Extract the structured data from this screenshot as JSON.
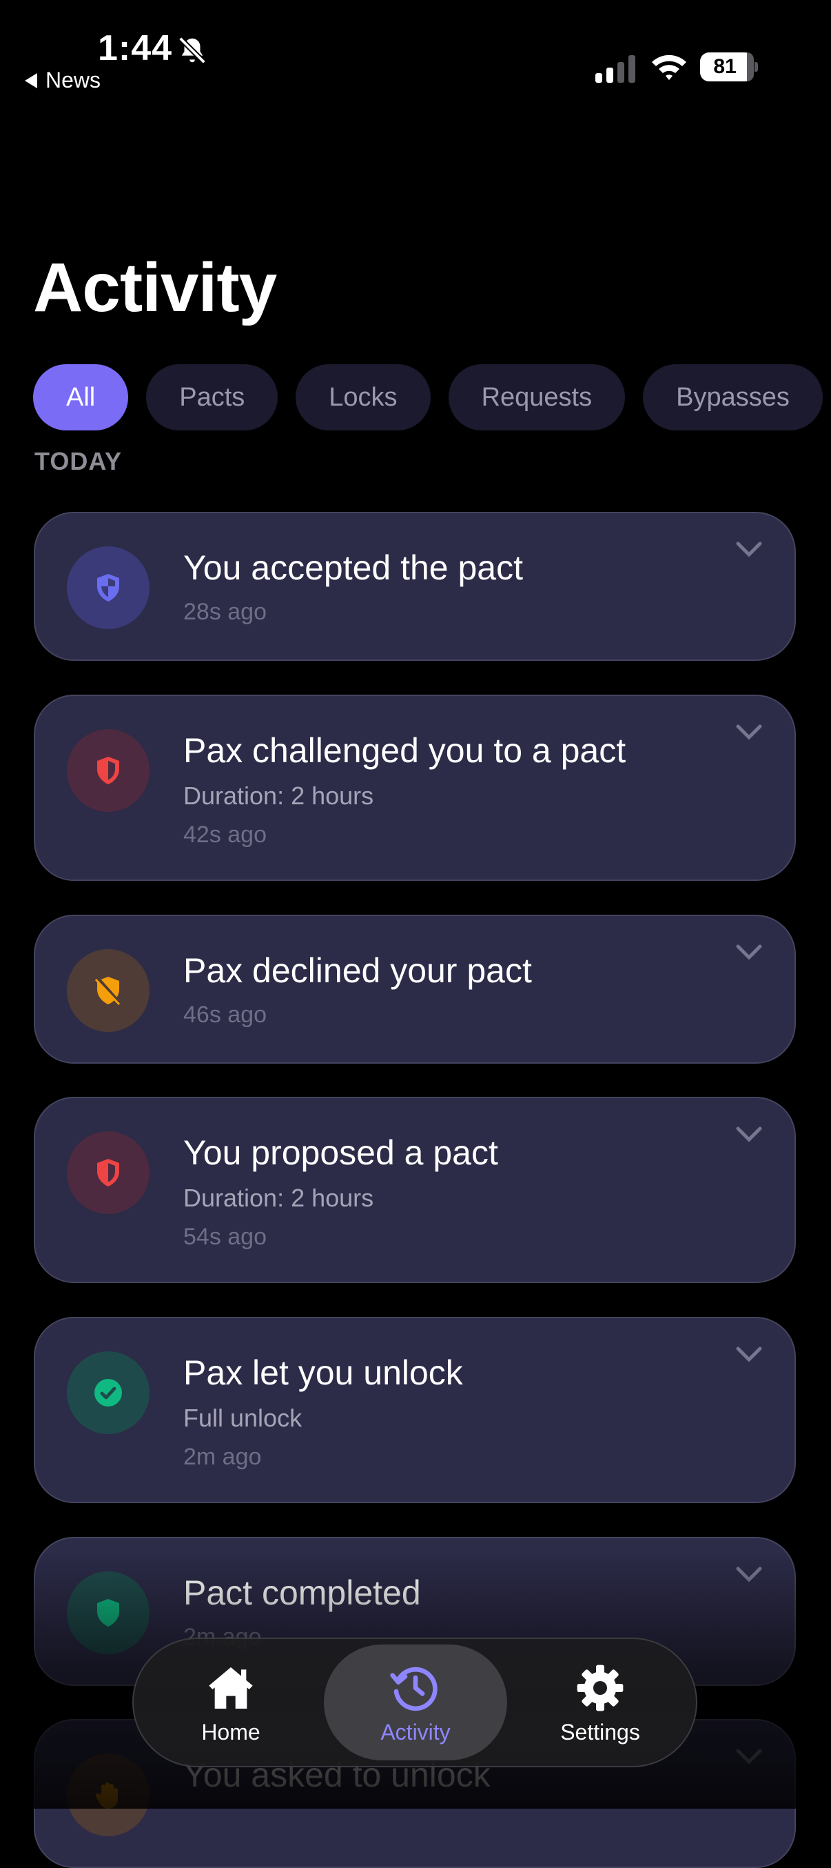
{
  "status_bar": {
    "time": "1:44",
    "back_label": "News",
    "battery": "81"
  },
  "header": {
    "title": "Activity"
  },
  "filters": [
    {
      "label": "All",
      "active": true
    },
    {
      "label": "Pacts",
      "active": false
    },
    {
      "label": "Locks",
      "active": false
    },
    {
      "label": "Requests",
      "active": false
    },
    {
      "label": "Bypasses",
      "active": false
    }
  ],
  "section": {
    "label": "TODAY"
  },
  "activities": [
    {
      "title": "You accepted the pact",
      "detail": "",
      "time": "28s ago",
      "icon": "shield-half-icon",
      "color": "#6a6df0"
    },
    {
      "title": "Pax challenged you to a pact",
      "detail": "Duration: 2 hours",
      "time": "42s ago",
      "icon": "shield-half-icon",
      "color": "#ef4444"
    },
    {
      "title": "Pax declined your pact",
      "detail": "",
      "time": "46s ago",
      "icon": "shield-slash-icon",
      "color": "#f59e0b"
    },
    {
      "title": "You proposed a pact",
      "detail": "Duration: 2 hours",
      "time": "54s ago",
      "icon": "shield-half-icon",
      "color": "#ef4444"
    },
    {
      "title": "Pax let you unlock",
      "detail": "Full unlock",
      "time": "2m ago",
      "icon": "check-circle-icon",
      "color": "#10b981"
    },
    {
      "title": "Pact completed",
      "detail": "",
      "time": "2m ago",
      "icon": "shield-icon",
      "color": "#10b981"
    },
    {
      "title": "You asked to unlock",
      "detail": "",
      "time": "",
      "icon": "hand-icon",
      "color": "#f59e0b"
    }
  ],
  "tabs": [
    {
      "label": "Home",
      "icon": "home-icon",
      "active": false
    },
    {
      "label": "Activity",
      "icon": "history-icon",
      "active": true
    },
    {
      "label": "Settings",
      "icon": "gear-icon",
      "active": false
    }
  ]
}
